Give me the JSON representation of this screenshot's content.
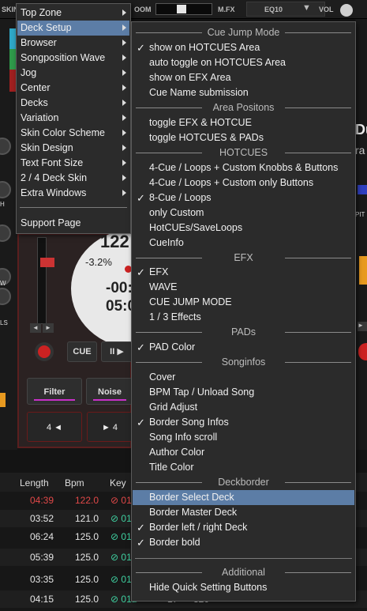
{
  "topbar": {
    "left_label": "SKIN",
    "zoom_label": "OOM",
    "mfx_label": "M.FX",
    "eq_label": "EQ10",
    "vol_label": "VOL"
  },
  "left_strip": {
    "labels": [
      "H",
      "W",
      "LS"
    ]
  },
  "deck": {
    "bpm_partial": "122",
    "pitch": "-3.2%",
    "time_remaining": "-00:",
    "time_elapsed": "05:0",
    "cue_label": "CUE",
    "play_label": "II ▶",
    "filter_label": "Filter",
    "noise_label": "Noise",
    "loop_left_label": "4 ◄",
    "loop_right_label": "► 4"
  },
  "right_edge": {
    "title_fragment": "Du",
    "subtitle_fragment": "ra",
    "pitch_label": "PIT"
  },
  "tracklist": {
    "headers": {
      "length": "Length",
      "bpm": "Bpm",
      "key": "Key"
    },
    "rows": [
      {
        "length": "04:39",
        "bpm": "122.0",
        "key": "⊘ 01"
      },
      {
        "length": "03:52",
        "bpm": "121.0",
        "key": "⊘ 01"
      },
      {
        "length": "06:24",
        "bpm": "125.0",
        "key": "⊘ 01"
      },
      {
        "length": "05:39",
        "bpm": "125.0",
        "key": "⊘ 01"
      },
      {
        "length": "03:35",
        "bpm": "125.0",
        "key": "⊘ 01"
      },
      {
        "length": "04:15",
        "bpm": "125.0",
        "key": "⊘ 01B",
        "extra1": "17",
        "extra2": "320"
      }
    ]
  },
  "main_menu": {
    "items": [
      {
        "label": "Top Zone",
        "submenu": true
      },
      {
        "label": "Deck Setup",
        "submenu": true
      },
      {
        "label": "Browser",
        "submenu": true
      },
      {
        "label": "Songposition Wave",
        "submenu": true
      },
      {
        "label": "Jog",
        "submenu": true
      },
      {
        "label": "Center",
        "submenu": true
      },
      {
        "label": "Decks",
        "submenu": true
      },
      {
        "label": "Variation",
        "submenu": true
      },
      {
        "label": "Skin Color Scheme",
        "submenu": true
      },
      {
        "label": "Skin Design",
        "submenu": true
      },
      {
        "label": "Text Font Size",
        "submenu": true
      },
      {
        "label": "2 / 4 Deck Skin",
        "submenu": true
      },
      {
        "label": "Extra Windows",
        "submenu": true
      },
      {
        "label": "Support Page",
        "submenu": false
      }
    ],
    "highlighted": "Deck Setup"
  },
  "submenu": {
    "sections": {
      "cue_jump_mode": "Cue Jump Mode",
      "area_positons": "Area Positons",
      "hotcues": "HOTCUES",
      "efx": "EFX",
      "pads": "PADs",
      "songinfos": "Songinfos",
      "deckborder": "Deckborder",
      "additional": "Additional"
    },
    "items": {
      "show_on_hotcues_area": "show on HOTCUES Area",
      "auto_toggle_on_hotcues_area": "auto toggle on HOTCUES Area",
      "show_on_efx_area": "show on EFX Area",
      "cue_name_submission": "Cue Name submission",
      "toggle_efx_hotcue": "toggle EFX & HOTCUE",
      "toggle_hotcues_pads": "toggle HOTCUES & PADs",
      "cue_loops_custom_knobbs_buttons": "4-Cue / Loops + Custom Knobbs & Buttons",
      "cue_loops_custom_only_buttons": "4-Cue / Loops + Custom only Buttons",
      "eight_cue_loops": "8-Cue / Loops",
      "only_custom": "only Custom",
      "hotcues_saveloops": "HotCUEs/SaveLoops",
      "cueinfo": "CueInfo",
      "efx": "EFX",
      "wave": "WAVE",
      "cue_jump_mode": "CUE JUMP MODE",
      "one_three_effects": "1 / 3 Effects",
      "pad_color": "PAD Color",
      "cover": "Cover",
      "bpm_tap_unload_song": "BPM Tap / Unload Song",
      "grid_adjust": "Grid Adjust",
      "border_song_infos": "Border Song Infos",
      "song_info_scroll": "Song Info scroll",
      "author_color": "Author Color",
      "title_color": "Title Color",
      "border_select_deck": "Border Select Deck",
      "border_master_deck": "Border Master Deck",
      "border_left_right_deck": "Border left / right Deck",
      "border_bold": "Border bold",
      "hide_quick_setting_buttons": "Hide Quick Setting Buttons"
    },
    "checked": [
      "show_on_hotcues_area",
      "eight_cue_loops",
      "efx",
      "pad_color",
      "border_song_infos",
      "border_left_right_deck",
      "border_bold"
    ],
    "highlighted": "border_select_deck",
    "checkmark": "✓"
  },
  "colors": {
    "menu_bg": "#2b2b2b",
    "highlight": "#5c7da6",
    "playing_track": "#e04848",
    "key_green": "#3fd0a0",
    "accent_magenta": "#c830c8"
  }
}
